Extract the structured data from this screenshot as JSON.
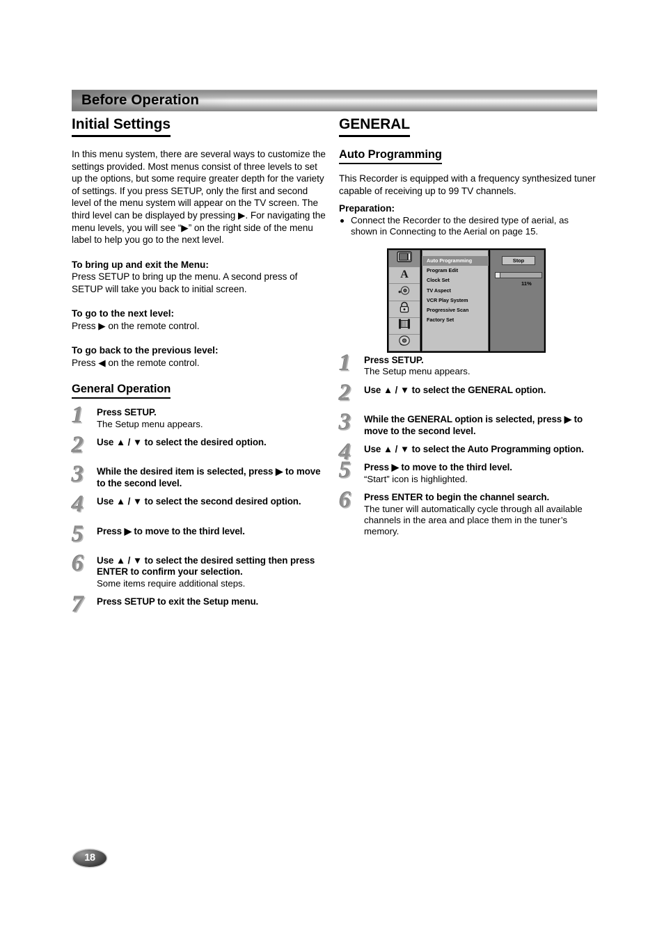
{
  "header": {
    "title": "Before Operation"
  },
  "page_number": "18",
  "left_column": {
    "section_title": "Initial Settings",
    "intro_paragraph": "In this menu system, there are several ways to customize the settings provided. Most menus consist of three levels to set up the options, but some require greater depth for the variety of settings. If you press SETUP, only the first and second level of the menu system will appear on the TV screen. The third level can be displayed by pressing ▶. For navigating the menu levels, you will see “▶” on the right side of the menu label to help you go to the next level.",
    "blocks": [
      {
        "heading": "To bring up and exit the Menu:",
        "text": "Press SETUP to bring up the menu. A second press of SETUP will take you back to initial screen."
      },
      {
        "heading": "To go to the next level:",
        "text": "Press ▶ on the remote control."
      },
      {
        "heading": "To go back to the previous level:",
        "text": "Press ◀ on the remote control."
      }
    ],
    "steps_title": "General Operation",
    "steps": [
      {
        "num": "1",
        "main": "Press SETUP.",
        "sub": "The Setup menu appears."
      },
      {
        "num": "2",
        "main": "Use ▲ / ▼ to select the desired option.",
        "sub": ""
      },
      {
        "num": "3",
        "main": "While the desired item is selected, press ▶ to move to the second level.",
        "sub": ""
      },
      {
        "num": "4",
        "main": "Use ▲ / ▼ to select the second desired option.",
        "sub": ""
      },
      {
        "num": "5",
        "main": "Press ▶ to move to the third level.",
        "sub": ""
      },
      {
        "num": "6",
        "main": "Use ▲ / ▼ to select the desired setting then press ENTER to confirm your selection.",
        "sub": "Some items require additional steps."
      },
      {
        "num": "7",
        "main": "Press SETUP to exit the Setup menu.",
        "sub": ""
      }
    ]
  },
  "right_column": {
    "section_title": "GENERAL",
    "sub_title": "Auto Programming",
    "intro_paragraph": "This Recorder is equipped with a frequency synthesized tuner capable of receiving up to 99 TV channels.",
    "preparation_heading": "Preparation:",
    "preparation_bullet": "Connect the Recorder to the desired type of aerial, as shown in Connecting to the Aerial on page 15.",
    "steps": [
      {
        "num": "1",
        "main": "Press SETUP.",
        "sub": "The Setup menu appears."
      },
      {
        "num": "2",
        "main": "Use ▲ / ▼ to select the GENERAL option.",
        "sub": ""
      },
      {
        "num": "3",
        "main": "While the GENERAL option is selected, press ▶ to move to the second level.",
        "sub": ""
      },
      {
        "num": "4",
        "main": "Use ▲ / ▼ to select the Auto Programming option.",
        "sub": ""
      },
      {
        "num": "5",
        "main": "Press ▶ to move to the third level.",
        "sub": "“Start” icon is highlighted."
      },
      {
        "num": "6",
        "main": "Press ENTER to begin the channel search.",
        "sub": "The tuner will automatically cycle through all available channels in the area and place them in the tuner’s memory."
      }
    ]
  },
  "osd_menu": {
    "sidebar_icons": [
      {
        "name": "tv-monitor-icon",
        "selected": true
      },
      {
        "name": "language-letter-a-icon",
        "selected": false
      },
      {
        "name": "audio-speaker-icon",
        "selected": false
      },
      {
        "name": "parental-lock-icon",
        "selected": false
      },
      {
        "name": "film-strip-icon",
        "selected": false
      },
      {
        "name": "disc-icon",
        "selected": false
      }
    ],
    "menu_items": [
      {
        "label": "Auto Programming",
        "highlighted": true
      },
      {
        "label": "Program Edit",
        "highlighted": false
      },
      {
        "label": "Clock Set",
        "highlighted": false
      },
      {
        "label": "TV Aspect",
        "highlighted": false
      },
      {
        "label": "VCR Play System",
        "highlighted": false
      },
      {
        "label": "Progressive Scan",
        "highlighted": false
      },
      {
        "label": "Factory Set",
        "highlighted": false
      }
    ],
    "action_button": "Stop",
    "progress_percent_label": "11%",
    "progress_percent_value": 11
  }
}
